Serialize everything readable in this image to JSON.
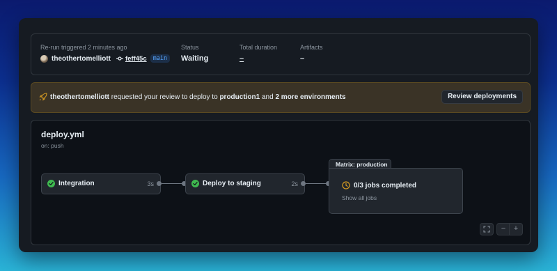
{
  "summary": {
    "trigger_label": "Re-run triggered 2 minutes ago",
    "user": "theothertomelliott",
    "commit_hash": "feff45c",
    "branch": "main",
    "status_label": "Status",
    "status_value": "Waiting",
    "duration_label": "Total duration",
    "duration_value": "–",
    "artifacts_label": "Artifacts",
    "artifacts_value": "–"
  },
  "banner": {
    "user": "theothertomelliott",
    "text_middle": " requested your review to deploy to ",
    "environment": "production1",
    "text_and": " and ",
    "more": "2 more environments",
    "button_label": "Review deployments",
    "accent_color": "#d29922"
  },
  "workflow": {
    "file": "deploy.yml",
    "trigger": "on: push",
    "jobs": [
      {
        "name": "Integration",
        "duration": "3s",
        "status": "success"
      },
      {
        "name": "Deploy to staging",
        "duration": "2s",
        "status": "success"
      }
    ],
    "matrix": {
      "title": "Matrix: production",
      "status": "0/3 jobs completed",
      "link": "Show all jobs"
    }
  },
  "controls": {
    "fullscreen_icon": "fullscreen-icon",
    "zoom_out_icon": "minus-icon",
    "zoom_in_icon": "plus-icon",
    "zoom_out_glyph": "−",
    "zoom_in_glyph": "+"
  },
  "colors": {
    "success": "#3fb950",
    "pending": "#d29922",
    "link": "#58a6ff"
  }
}
